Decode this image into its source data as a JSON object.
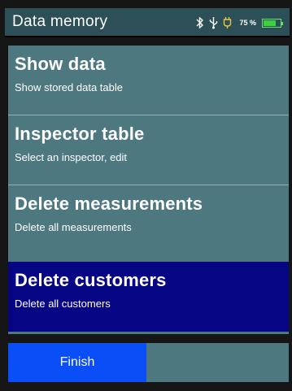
{
  "header": {
    "title": "Data memory",
    "battery_percent_label": "75 %",
    "battery_level": 0.75,
    "status_icons": [
      "bluetooth-icon",
      "usb-icon",
      "plug-icon",
      "battery-icon"
    ]
  },
  "menu": {
    "items": [
      {
        "label": "Show data",
        "description": "Show stored data table"
      },
      {
        "label": "Inspector table",
        "description": "Select an inspector, edit"
      },
      {
        "label": "Delete measurements",
        "description": "Delete all measurements"
      },
      {
        "label": "Delete customers",
        "description": "Delete all customers",
        "selected": true
      }
    ]
  },
  "footer": {
    "finish_label": "Finish"
  },
  "colors": {
    "header_bg": "#2c4f58",
    "menu_bg": "#4d7880",
    "selected_bg": "#060584",
    "button_bg": "#0a4ef7",
    "battery_green": "#3cd23c"
  }
}
